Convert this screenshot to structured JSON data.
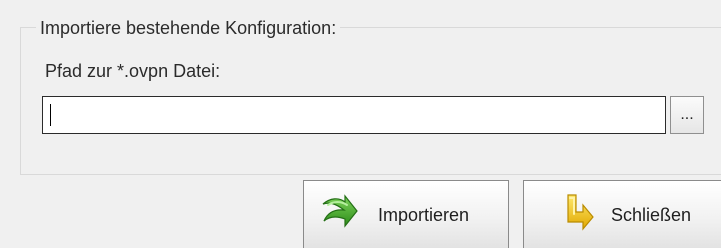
{
  "dialog": {
    "group_title": "Importiere bestehende Konfiguration:",
    "path_label": "Pfad zur *.ovpn Datei:",
    "path_value": "",
    "browse_label": "...",
    "import_label": "Importieren",
    "close_label": "Schließen"
  },
  "icons": {
    "import": "green-arrow-right-icon",
    "close": "yellow-arrow-back-icon"
  },
  "colors": {
    "import_icon": "#3e9f2a",
    "close_icon": "#f2c40d"
  }
}
